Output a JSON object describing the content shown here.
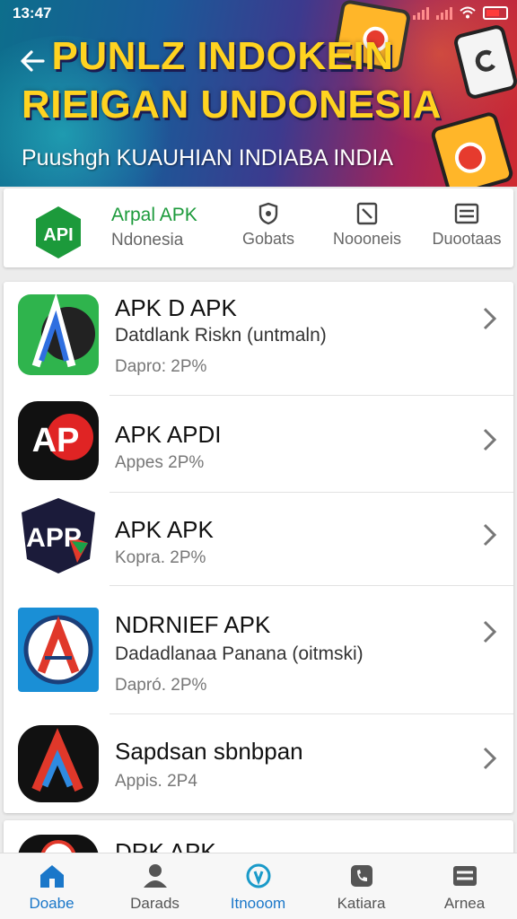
{
  "status_bar": {
    "time": "13:47"
  },
  "banner": {
    "title_line1": "PUNLZ INDOKEIN",
    "title_line2": "RIEIGAN UNDONESIA",
    "subtitle": "Puushgh KUAUHIAN INDIABA INDIA"
  },
  "brand": {
    "logo_text": "API",
    "name": "Arpal APK",
    "sub": "Ndonesia"
  },
  "tabs": [
    {
      "label": "Gobats",
      "icon": "shield-icon"
    },
    {
      "label": "Noooneis",
      "icon": "document-icon"
    },
    {
      "label": "Duootaas",
      "icon": "menu-icon"
    }
  ],
  "apps": [
    {
      "name": "APK D APK",
      "desc": "Datdlank Riskn (untmaln)",
      "size": "Dapro: 2P%"
    },
    {
      "name": "APK APDI",
      "desc": "",
      "size": "Appes 2P%",
      "icon_text": "AP"
    },
    {
      "name": "APK APK",
      "desc": "",
      "size": "Kopra. 2P%",
      "icon_text": "APP"
    },
    {
      "name": "NDRNIEF APK",
      "desc": "Dadadlanaa Panana (oitmski)",
      "size": "Dapró. 2P%"
    },
    {
      "name": "Sapdsan sbnbpan",
      "desc": "",
      "size": "Appis. 2P4"
    }
  ],
  "partial_app": {
    "name": "DRK APK"
  },
  "bottom_nav": [
    {
      "label": "Doabe",
      "icon": "home-icon",
      "active": true
    },
    {
      "label": "Darads",
      "icon": "person-icon",
      "active": false
    },
    {
      "label": "Itnooom",
      "icon": "compass-icon",
      "active": false
    },
    {
      "label": "Katiara",
      "icon": "phone-icon",
      "active": false
    },
    {
      "label": "Arnea",
      "icon": "menu-icon",
      "active": false
    }
  ],
  "colors": {
    "accent": "#1a77c9",
    "brand_green": "#1c9a3b",
    "title_yellow": "#ffd320"
  }
}
